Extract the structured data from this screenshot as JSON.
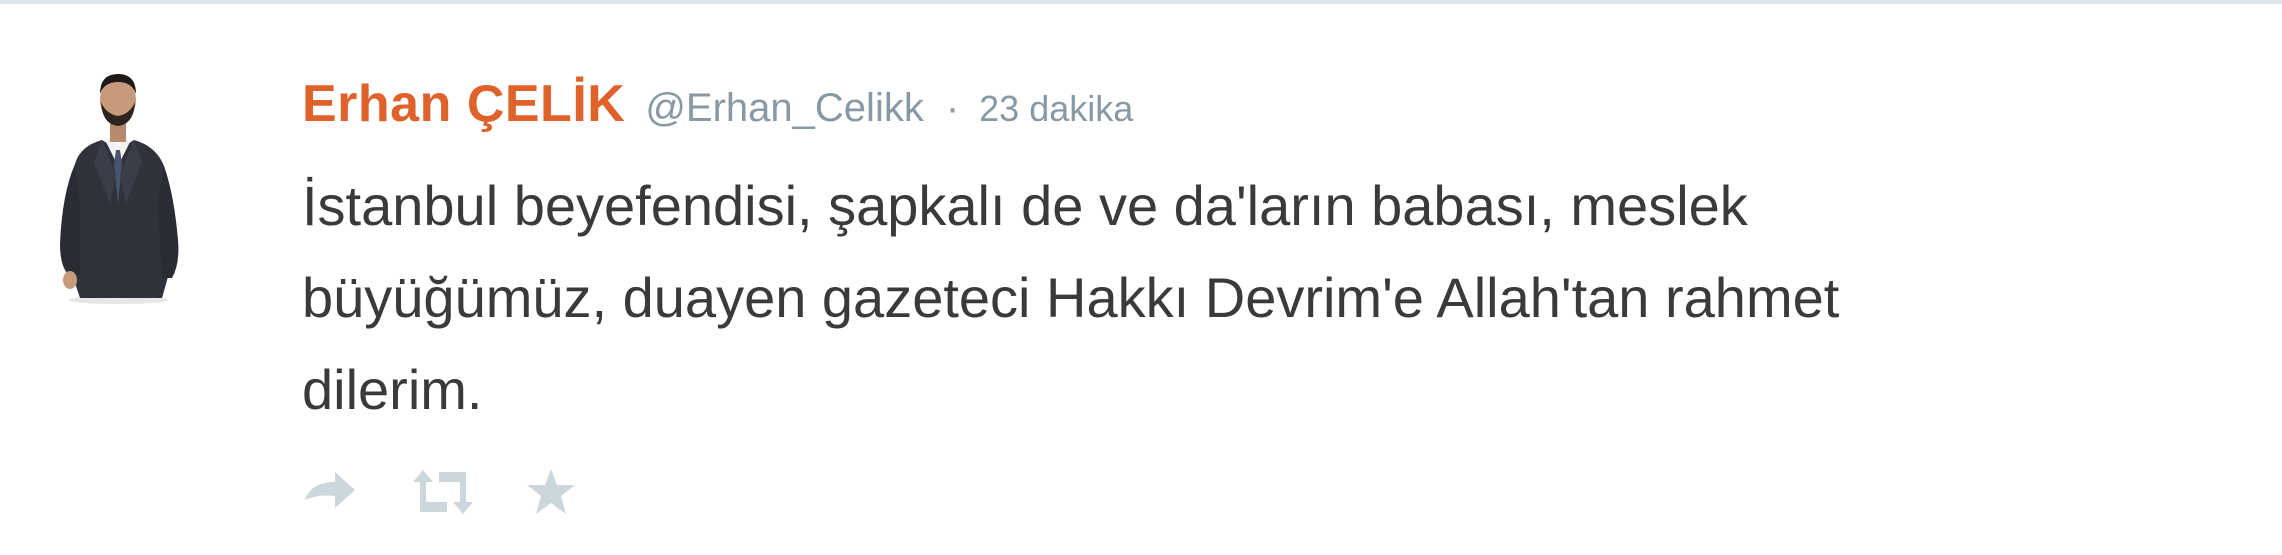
{
  "tweet": {
    "author": {
      "fullname": "Erhan ÇELİK",
      "username": "@Erhan_Celikk"
    },
    "separator": "·",
    "timestamp": "23 dakika",
    "text_lines": [
      "İstanbul beyefendisi, şapkalı de ve da'ların babası, meslek",
      "büyüğümüz, duayen gazeteci Hakkı Devrim'e Allah'tan rahmet",
      "dilerim."
    ],
    "actions": [
      {
        "name": "reply",
        "icon": "reply-arrow-icon"
      },
      {
        "name": "retweet",
        "icon": "retweet-icon"
      },
      {
        "name": "favorite",
        "icon": "star-icon"
      }
    ]
  },
  "colors": {
    "fullname": "#e0622b",
    "meta": "#8899a6",
    "text": "#3a3a3a",
    "action_icon": "#ccd6dd"
  }
}
